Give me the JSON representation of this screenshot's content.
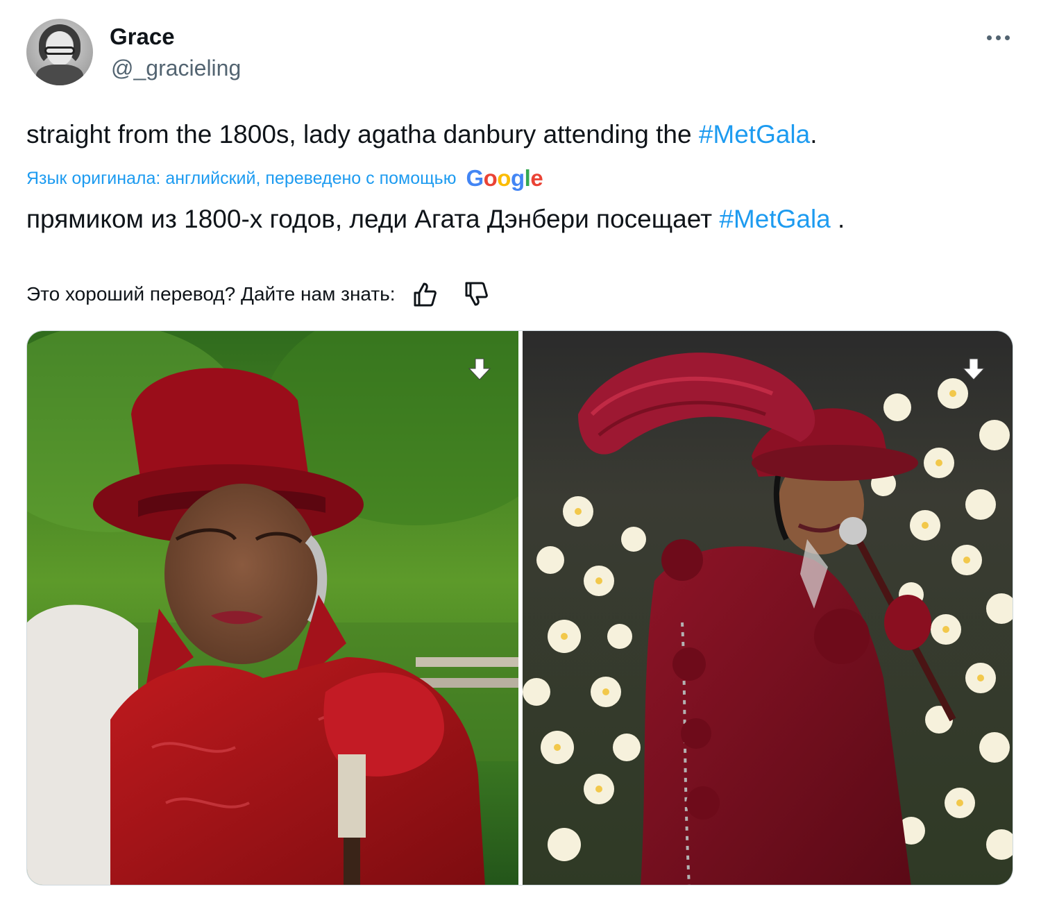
{
  "tweet": {
    "display_name": "Grace",
    "handle": "@_gracieling",
    "text_prefix": "straight from the 1800s, lady agatha danbury attending the ",
    "hashtag": "#MetGala",
    "text_suffix": ".",
    "translated_by": "Язык оригинала: английский, переведено с помощью",
    "google_logo": [
      "G",
      "o",
      "o",
      "g",
      "l",
      "e"
    ],
    "translation_prefix": "прямиком из 1800-х годов, леди Агата Дэнбери посещает ",
    "translation_hashtag": "#MetGala",
    "translation_suffix": " .",
    "feedback_prompt": "Это хороший перевод? Дайте нам знать:"
  },
  "icons": {
    "moon": "crescent-moon-icon",
    "more": "more-dots-icon",
    "like": "thumbs-up-icon",
    "dislike": "thumbs-down-icon",
    "download": "download-arrow-icon"
  },
  "colors": {
    "text": "#0f1419",
    "secondary": "#536471",
    "link": "#1d9bf0",
    "google_blue": "#4285f4",
    "google_red": "#ea4335",
    "google_yellow": "#fbbc05",
    "google_green": "#34a853"
  }
}
